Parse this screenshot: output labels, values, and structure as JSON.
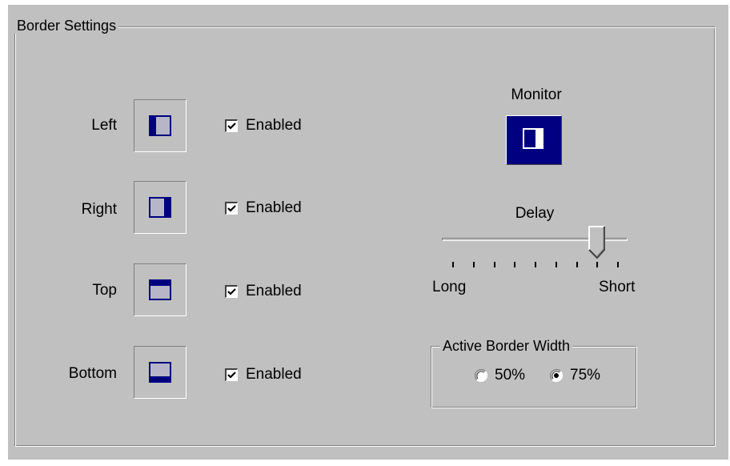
{
  "group": {
    "title": "Border Settings"
  },
  "borders": [
    {
      "label": "Left",
      "side": "left",
      "checkbox_label": "Enabled",
      "checked": true
    },
    {
      "label": "Right",
      "side": "right",
      "checkbox_label": "Enabled",
      "checked": true
    },
    {
      "label": "Top",
      "side": "top",
      "checkbox_label": "Enabled",
      "checked": true
    },
    {
      "label": "Bottom",
      "side": "bottom",
      "checkbox_label": "Enabled",
      "checked": true
    }
  ],
  "monitor": {
    "label": "Monitor"
  },
  "delay": {
    "label": "Delay",
    "min_label": "Long",
    "max_label": "Short",
    "tick_count": 9,
    "position": 7
  },
  "active_border_width": {
    "title": "Active Border Width",
    "options": [
      {
        "label": "50%",
        "selected": false
      },
      {
        "label": "75%",
        "selected": true
      }
    ]
  },
  "colors": {
    "window_bg": "#c0c0c0",
    "accent_navy": "#000080",
    "shadow": "#808080",
    "highlight": "#ffffff"
  },
  "icons": {
    "checkmark": "checkmark-icon",
    "radio_dot": "radio-dot-icon",
    "slider_thumb": "slider-thumb-icon"
  }
}
